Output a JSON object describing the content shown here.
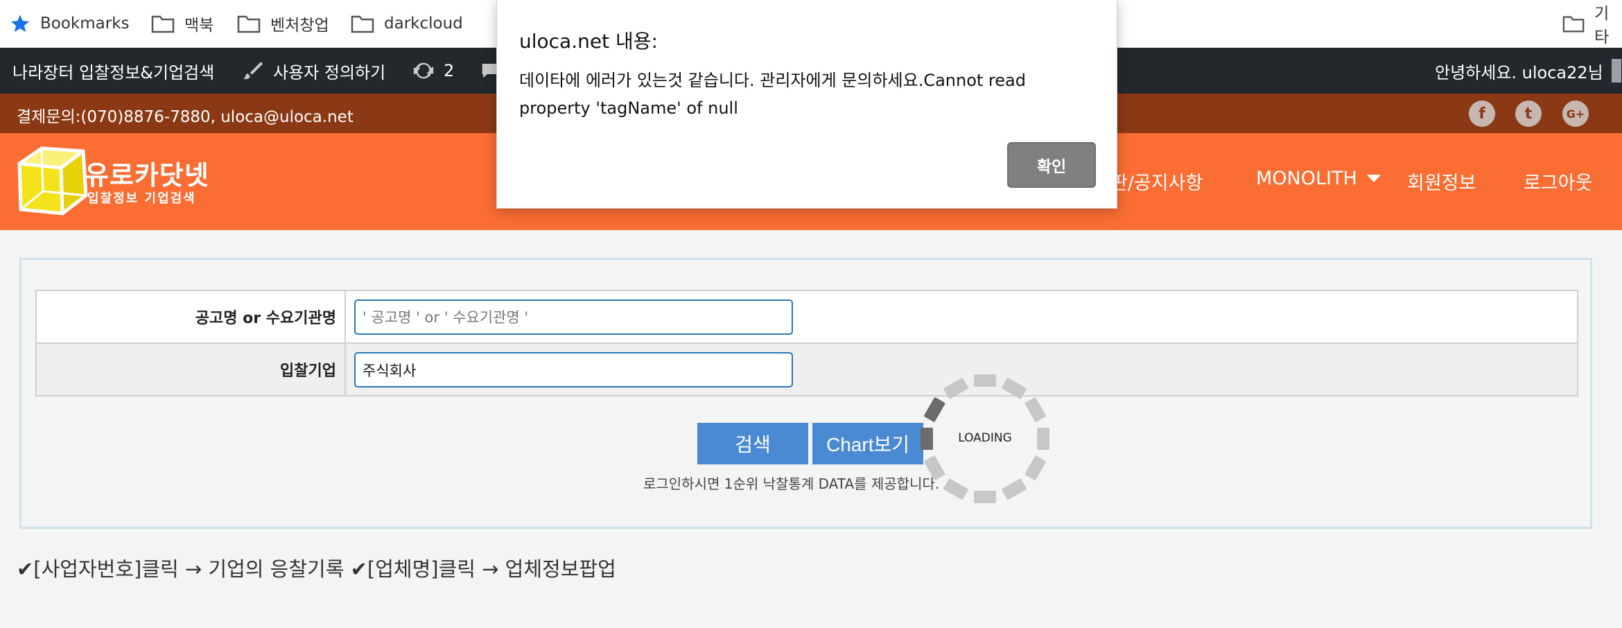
{
  "bookmarks": {
    "items": [
      {
        "label": "Bookmarks",
        "icon": "star-icon"
      },
      {
        "label": "맥북",
        "icon": "folder-icon"
      },
      {
        "label": "벤처창업",
        "icon": "folder-icon"
      },
      {
        "label": "darkcloud",
        "icon": "folder-icon"
      }
    ],
    "other_label": "기타"
  },
  "adminbar": {
    "site_label": "나라장터 입찰정보&기업검색",
    "customize_label": "사용자 정의하기",
    "updates_count": "2",
    "greeting": "안녕하세요. uloca22님"
  },
  "contact": {
    "text": "결제문의:(070)8876-7880, uloca@uloca.net",
    "social": [
      "f",
      "t",
      "G+"
    ]
  },
  "header": {
    "logo_title": "유로카닷넷",
    "logo_subtitle": "입찰정보 기업검색",
    "nav": [
      {
        "label": "판/공지사항"
      },
      {
        "label": "MONOLITH",
        "has_dropdown": true
      },
      {
        "label": "회원정보"
      },
      {
        "label": "로그아웃"
      }
    ]
  },
  "search_form": {
    "row1_label": "공고명 or 수요기관명",
    "row1_placeholder": "' 공고명 ' or ' 수요기관명 '",
    "row1_value": "",
    "row2_label": "입찰기업",
    "row2_value": "주식회사",
    "search_button": "검색",
    "chart_button": "Chart보기",
    "note": "로그인하시면 1순위 낙찰통계 DATA를 제공합니다."
  },
  "loader": {
    "text": "LOADING"
  },
  "footer_note": "✔[사업자번호]클릭 → 기업의 응찰기록 ✔[업체명]클릭 → 업체정보팝업",
  "dialog": {
    "title": "uloca.net 내용:",
    "message": "데이타에 에러가 있는것 같습니다. 관리자에게 문의하세요.Cannot read property 'tagName' of null",
    "ok_label": "확인"
  },
  "colors": {
    "header_orange": "#fa6d33",
    "contact_brown": "#8b3914",
    "adminbar_dark": "#23282d",
    "button_blue": "#4a8ad2",
    "input_border": "#2a78b5"
  }
}
